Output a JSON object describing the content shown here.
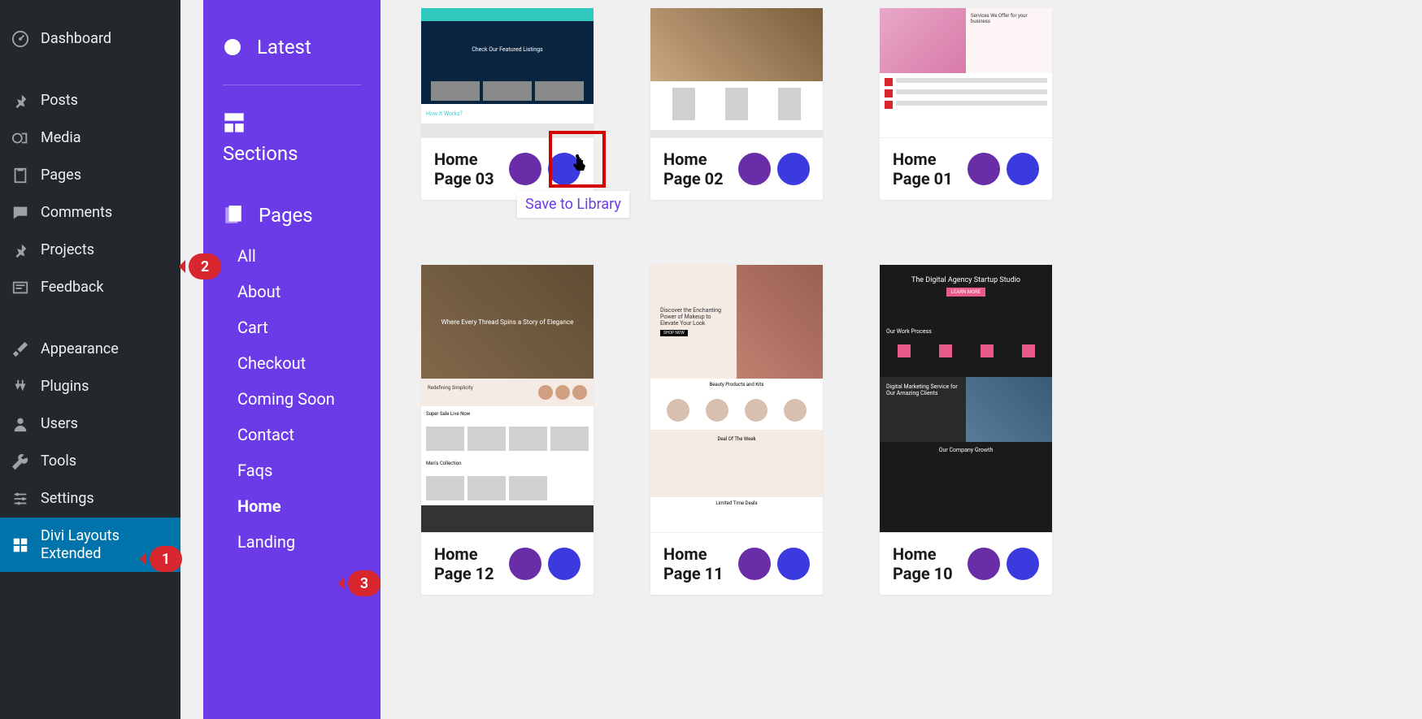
{
  "wp_menu": {
    "dashboard": "Dashboard",
    "posts": "Posts",
    "media": "Media",
    "pages": "Pages",
    "comments": "Comments",
    "projects": "Projects",
    "feedback": "Feedback",
    "appearance": "Appearance",
    "plugins": "Plugins",
    "users": "Users",
    "tools": "Tools",
    "settings": "Settings",
    "divi": "Divi Layouts Extended"
  },
  "secondary": {
    "latest": "Latest",
    "sections": "Sections",
    "pages": "Pages",
    "sub": {
      "all": "All",
      "about": "About",
      "cart": "Cart",
      "checkout": "Checkout",
      "coming_soon": "Coming Soon",
      "contact": "Contact",
      "faqs": "Faqs",
      "home": "Home",
      "landing": "Landing"
    }
  },
  "cards": {
    "r1c1": "Home Page 03",
    "r1c2": "Home Page 02",
    "r1c3": "Home Page 01",
    "r2c1": "Home Page 12",
    "r2c2": "Home Page 11",
    "r2c3": "Home Page 10"
  },
  "tooltip": "Save to Library",
  "badges": {
    "b1": "1",
    "b2": "2",
    "b3": "3"
  },
  "thumbs": {
    "hp03_hero": "Check Our Featured Listings",
    "hp03_how": "How It Works?",
    "hp01_services": "Services We Offer for your business",
    "hp12_hero": "Where Every Thread Spins a Story of Elegance",
    "hp11_hero": "Discover the Enchanting Power of Makeup to Elevate Your Look",
    "hp11_prods": "Beauty Products and Kits",
    "hp11_deal": "Deal Of The Week",
    "hp10_hero": "The Digital Agency Startup Studio",
    "hp10_process": "Our Work Process",
    "hp10_service": "Digital Marketing Service for Our Amazing Clients",
    "hp10_growth": "Our Company Growth"
  }
}
